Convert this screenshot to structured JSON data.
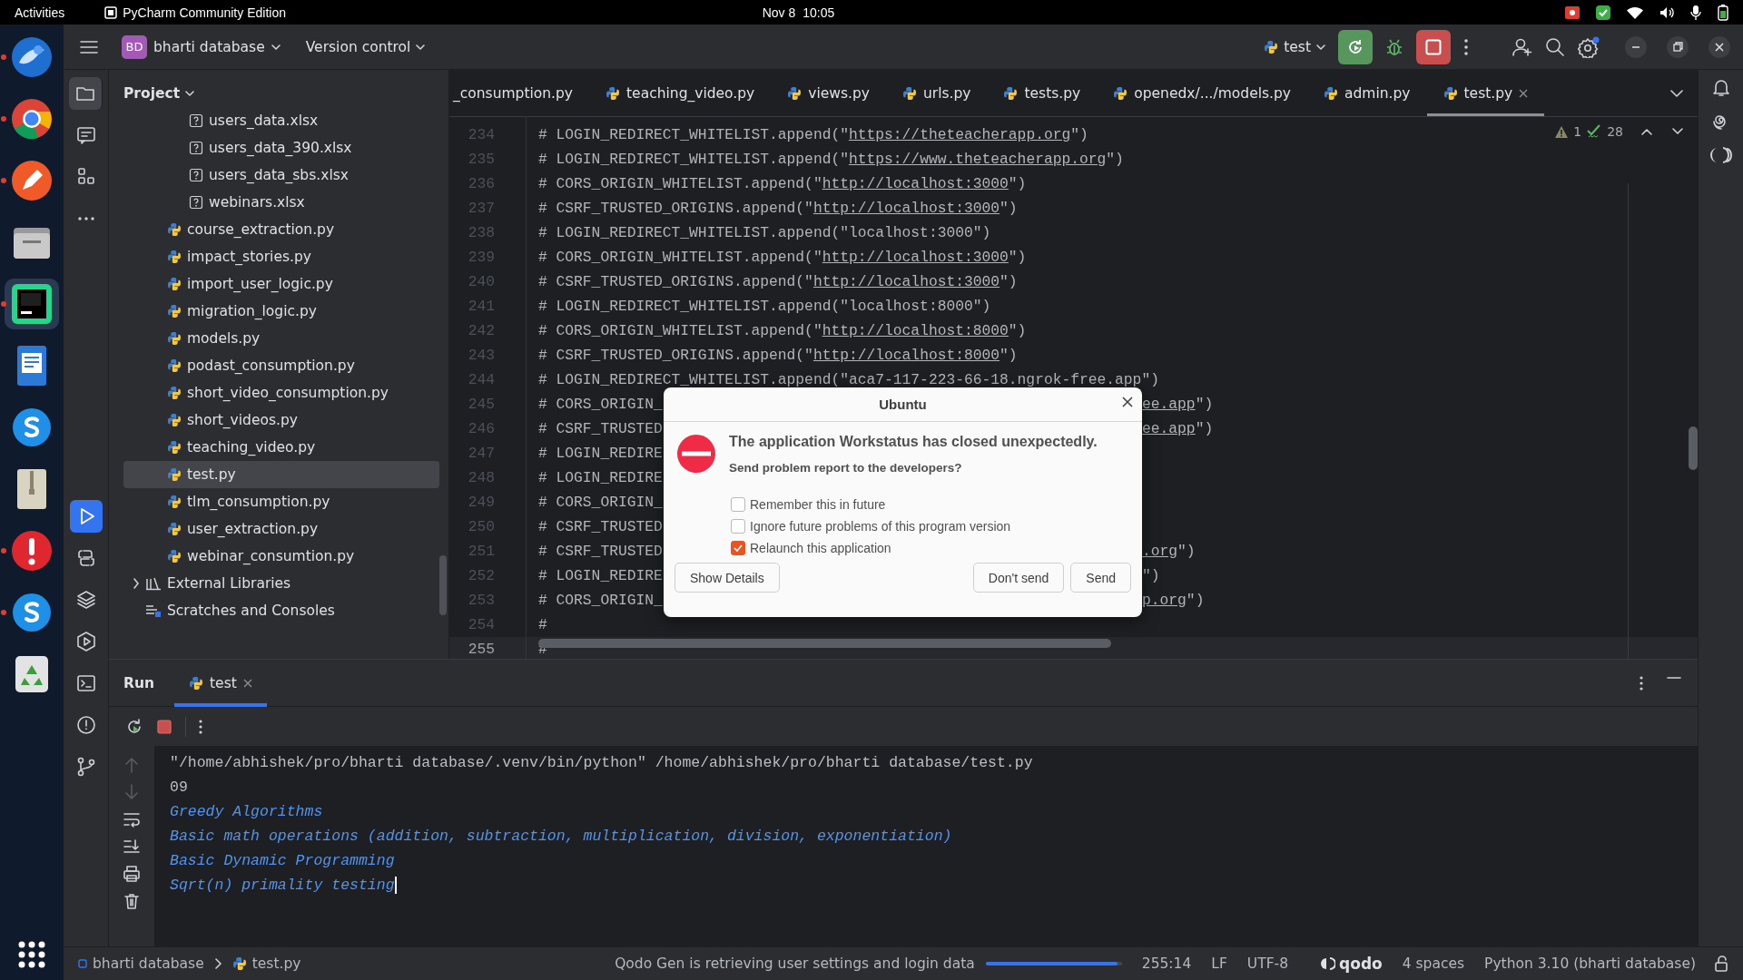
{
  "top_bar": {
    "activities": "Activities",
    "app_name": "PyCharm Community Edition",
    "date": "Nov 8",
    "time": "10:05"
  },
  "dock": {
    "items": [
      {
        "kind": "mail",
        "selected": false,
        "running": true
      },
      {
        "kind": "browser",
        "selected": false,
        "running": true
      },
      {
        "kind": "pen",
        "selected": false,
        "running": true
      },
      {
        "kind": "files",
        "selected": false,
        "running": false
      },
      {
        "kind": "ide",
        "selected": true,
        "running": true
      },
      {
        "kind": "document",
        "selected": false,
        "running": false
      },
      {
        "kind": "chat",
        "selected": false,
        "running": false
      },
      {
        "kind": "archive",
        "selected": false,
        "running": false
      },
      {
        "kind": "alert",
        "selected": false,
        "running": true
      },
      {
        "kind": "chat",
        "selected": false,
        "running": true
      },
      {
        "kind": "recycle",
        "selected": false,
        "running": false
      }
    ]
  },
  "header": {
    "project_badge": "BD",
    "project_name": "bharti database",
    "vcs": "Version control",
    "run_config": "test"
  },
  "tool_windows": {
    "top": [
      {
        "kind": "project",
        "selected": true
      },
      {
        "kind": "commit",
        "selected": false
      },
      {
        "kind": "structure",
        "selected": false
      },
      {
        "kind": "more",
        "selected": false
      }
    ],
    "bottom": [
      {
        "kind": "run",
        "selected": true
      },
      {
        "kind": "console",
        "selected": false
      },
      {
        "kind": "layers",
        "selected": false
      },
      {
        "kind": "services",
        "selected": false
      },
      {
        "kind": "terminal",
        "selected": false
      },
      {
        "kind": "problems",
        "selected": false
      },
      {
        "kind": "git",
        "selected": false
      }
    ]
  },
  "project": {
    "title": "Project",
    "tree": [
      {
        "children": [
          {
            "children": [
              {
                "label": "users_data.xlsx",
                "kind": "unknown",
                "selected": false
              },
              {
                "label": "users_data_390.xlsx",
                "kind": "unknown",
                "selected": false
              },
              {
                "label": "users_data_sbs.xlsx",
                "kind": "unknown",
                "selected": false
              },
              {
                "label": "webinars.xlsx",
                "kind": "unknown",
                "selected": false
              }
            ]
          },
          {
            "label": "course_extraction.py",
            "kind": "python",
            "selected": false
          },
          {
            "label": "impact_stories.py",
            "kind": "python",
            "selected": false
          },
          {
            "label": "import_user_logic.py",
            "kind": "python",
            "selected": false
          },
          {
            "label": "migration_logic.py",
            "kind": "python",
            "selected": false
          },
          {
            "label": "models.py",
            "kind": "python",
            "selected": false
          },
          {
            "label": "podast_consumption.py",
            "kind": "python",
            "selected": false
          },
          {
            "label": "short_video_consumption.py",
            "kind": "python",
            "selected": false
          },
          {
            "label": "short_videos.py",
            "kind": "python",
            "selected": false
          },
          {
            "label": "teaching_video.py",
            "kind": "python",
            "selected": false
          },
          {
            "label": "test.py",
            "kind": "python",
            "selected": true
          },
          {
            "label": "tlm_consumption.py",
            "kind": "python",
            "selected": false
          },
          {
            "label": "user_extraction.py",
            "kind": "python",
            "selected": false
          },
          {
            "label": "webinar_consumtion.py",
            "kind": "python",
            "selected": false
          }
        ]
      },
      {
        "label": "External Libraries",
        "kind": "library",
        "selected": false,
        "expanded": false
      },
      {
        "label": "Scratches and Consoles",
        "kind": "scratches",
        "selected": false
      }
    ]
  },
  "editor": {
    "tabs": [
      {
        "label": "_consumption.py",
        "icon": false,
        "selected": false,
        "closable": false
      },
      {
        "label": "teaching_video.py",
        "icon": true,
        "selected": false,
        "closable": false
      },
      {
        "label": "views.py",
        "icon": true,
        "selected": false,
        "closable": false
      },
      {
        "label": "urls.py",
        "icon": true,
        "selected": false,
        "closable": false
      },
      {
        "label": "tests.py",
        "icon": true,
        "selected": false,
        "closable": false
      },
      {
        "label": "openedx/.../models.py",
        "icon": true,
        "selected": false,
        "closable": false
      },
      {
        "label": "admin.py",
        "icon": true,
        "selected": false,
        "closable": false
      },
      {
        "label": "test.py",
        "icon": true,
        "selected": true,
        "closable": true
      }
    ],
    "inspections": {
      "warnings": "1",
      "weak_warnings": "28"
    },
    "lines": [
      {
        "number": "234",
        "current": false,
        "code": [
          {
            "text": "# LOGIN_REDIRECT_WHITELIST.append(\"",
            "link": false
          },
          {
            "text": "https://theteacherapp.org",
            "link": true
          },
          {
            "text": "\")",
            "link": false
          }
        ]
      },
      {
        "number": "235",
        "current": false,
        "code": [
          {
            "text": "# LOGIN_REDIRECT_WHITELIST.append(\"",
            "link": false
          },
          {
            "text": "https://www.theteacherapp.org",
            "link": true
          },
          {
            "text": "\")",
            "link": false
          }
        ]
      },
      {
        "number": "236",
        "current": false,
        "code": [
          {
            "text": "# CORS_ORIGIN_WHITELIST.append(\"",
            "link": false
          },
          {
            "text": "http://localhost:3000",
            "link": true
          },
          {
            "text": "\")",
            "link": false
          }
        ]
      },
      {
        "number": "237",
        "current": false,
        "code": [
          {
            "text": "# CSRF_TRUSTED_ORIGINS.append(\"",
            "link": false
          },
          {
            "text": "http://localhost:3000",
            "link": true
          },
          {
            "text": "\")",
            "link": false
          }
        ]
      },
      {
        "number": "238",
        "current": false,
        "code": [
          {
            "text": "# LOGIN_REDIRECT_WHITELIST.append(\"localhost:3000\")",
            "link": false
          }
        ]
      },
      {
        "number": "239",
        "current": false,
        "code": [
          {
            "text": "# CORS_ORIGIN_WHITELIST.append(\"",
            "link": false
          },
          {
            "text": "http://localhost:3000",
            "link": true
          },
          {
            "text": "\")",
            "link": false
          }
        ]
      },
      {
        "number": "240",
        "current": false,
        "code": [
          {
            "text": "# CSRF_TRUSTED_ORIGINS.append(\"",
            "link": false
          },
          {
            "text": "http://localhost:3000",
            "link": true
          },
          {
            "text": "\")",
            "link": false
          }
        ]
      },
      {
        "number": "241",
        "current": false,
        "code": [
          {
            "text": "# LOGIN_REDIRECT_WHITELIST.append(\"localhost:8000\")",
            "link": false
          }
        ]
      },
      {
        "number": "242",
        "current": false,
        "code": [
          {
            "text": "# CORS_ORIGIN_WHITELIST.append(\"",
            "link": false
          },
          {
            "text": "http://localhost:8000",
            "link": true
          },
          {
            "text": "\")",
            "link": false
          }
        ]
      },
      {
        "number": "243",
        "current": false,
        "code": [
          {
            "text": "# CSRF_TRUSTED_ORIGINS.append(\"",
            "link": false
          },
          {
            "text": "http://localhost:8000",
            "link": true
          },
          {
            "text": "\")",
            "link": false
          }
        ]
      },
      {
        "number": "244",
        "current": false,
        "code": [
          {
            "text": "# LOGIN_REDIRECT_WHITELIST.append(\"aca7-117-223-66-18.ngrok-free.app\")",
            "link": false
          }
        ]
      },
      {
        "number": "245",
        "current": false,
        "code": [
          {
            "text": "# CORS_ORIGIN_",
            "link": false
          }
        ],
        "tail": [
          {
            "text": "ee.app",
            "link": true
          },
          {
            "text": "\")",
            "link": false
          }
        ]
      },
      {
        "number": "246",
        "current": false,
        "code": [
          {
            "text": "# CSRF_TRUSTED",
            "link": false
          }
        ],
        "tail": [
          {
            "text": "ee.app",
            "link": true
          },
          {
            "text": "\")",
            "link": false
          }
        ]
      },
      {
        "number": "247",
        "current": false,
        "code": [
          {
            "text": "# LOGIN_REDIRE",
            "link": false
          }
        ]
      },
      {
        "number": "248",
        "current": false,
        "code": [
          {
            "text": "# LOGIN_REDIRE",
            "link": false
          }
        ]
      },
      {
        "number": "249",
        "current": false,
        "code": [
          {
            "text": "# CORS_ORIGIN_",
            "link": false
          }
        ]
      },
      {
        "number": "250",
        "current": false,
        "code": [
          {
            "text": "# CSRF_TRUSTED",
            "link": false
          }
        ]
      },
      {
        "number": "251",
        "current": false,
        "code": [
          {
            "text": "# CSRF_TRUSTED",
            "link": false
          }
        ],
        "tail": [
          {
            "text": ".org",
            "link": true
          },
          {
            "text": "\")",
            "link": false
          }
        ]
      },
      {
        "number": "252",
        "current": false,
        "code": [
          {
            "text": "# LOGIN_REDIRE",
            "link": false
          }
        ],
        "tail": [
          {
            "text": "\")",
            "link": false
          }
        ]
      },
      {
        "number": "253",
        "current": false,
        "code": [
          {
            "text": "# CORS_ORIGIN_",
            "link": false
          }
        ],
        "tail": [
          {
            "text": "p.org",
            "link": true
          },
          {
            "text": "\")",
            "link": false
          }
        ]
      },
      {
        "number": "254",
        "current": false,
        "code": [
          {
            "text": "#",
            "link": false
          }
        ]
      },
      {
        "number": "255",
        "current": true,
        "code": [
          {
            "text": "#",
            "link": false
          }
        ]
      }
    ]
  },
  "dialog": {
    "title": "Ubuntu",
    "heading": "The application Workstatus has closed unexpectedly.",
    "question": "Send problem report to the developers?",
    "options": [
      {
        "label": "Remember this in future",
        "checked": false
      },
      {
        "label": "Ignore future problems of this program version",
        "checked": false
      },
      {
        "label": "Relaunch this application",
        "checked": true
      }
    ],
    "buttons": [
      {
        "label": "Show Details"
      },
      {
        "label": "Don't send"
      },
      {
        "label": "Send"
      }
    ]
  },
  "run": {
    "title": "Run",
    "tabs": [
      {
        "label": "test",
        "selected": true
      }
    ],
    "output": [
      {
        "kind": "plain",
        "text": "\"/home/abhishek/pro/bharti database/.venv/bin/python\" /home/abhishek/pro/bharti database/test.py",
        "cursor": false
      },
      {
        "kind": "plain",
        "text": "09",
        "cursor": false
      },
      {
        "kind": "highlight",
        "text": "Greedy Algorithms",
        "cursor": false
      },
      {
        "kind": "highlight",
        "text": "Basic math operations (addition, subtraction, multiplication, division, exponentiation)",
        "cursor": false
      },
      {
        "kind": "highlight",
        "text": "Basic Dynamic Programming",
        "cursor": false
      },
      {
        "kind": "highlight",
        "text": "Sqrt(n) primality testing",
        "cursor": true
      }
    ]
  },
  "status_bar": {
    "breadcrumb": [
      "bharti database",
      "test.py"
    ],
    "task": "Qodo Gen is retrieving user settings and login data",
    "progress": {
      "level": 0.97
    },
    "position": "255:14",
    "line_ending": "LF",
    "encoding": "UTF-8",
    "plugin": "qodo",
    "indent": "4 spaces",
    "interpreter": "Python 3.10 (bharti database)"
  }
}
